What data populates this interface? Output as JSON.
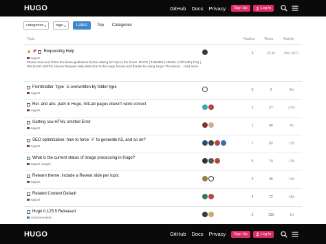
{
  "header": {
    "logo": "HUGO",
    "links": [
      "GitHub",
      "Docs",
      "Privacy"
    ],
    "signup": "Sign Up",
    "login": "Log In"
  },
  "filters": {
    "categories": "categories",
    "tags": "tags",
    "latest": "Latest",
    "top": "Top",
    "categories_tab": "Categories"
  },
  "table_headers": {
    "topic": "Topic",
    "replies": "Replies",
    "views": "Views",
    "activity": "Activity"
  },
  "topics": [
    {
      "title": "Requesting Help",
      "tag": "support",
      "tag_color": "#8b2f8b",
      "excerpt": "Please read and follow the below guidelines before asking for help in the forum. DOCS | THEMES | NEWS | GITHUB | FAQ | RELEASE NOTES How to Request Help Welcome to the Hugo forums and thanks for using Hugo! The below… read more",
      "replies": "9",
      "views": "25.4k",
      "activity": "Nov 2017",
      "pinned": true
    },
    {
      "title": "Frontmatter `type` is overwritten by folder type",
      "tag": "support",
      "tag_color": "#8b2f8b",
      "replies": "0",
      "views": "2",
      "activity": "4m"
    },
    {
      "title": "Rel. and abs. path in Hugo, GitLab pages doesn't work correct",
      "tag": "support",
      "tag_color": "#8b2f8b",
      "replies": "1",
      "views": "27",
      "activity": "37m"
    },
    {
      "title": "Getting raw HTML omitted Error",
      "tag": "support",
      "tag_color": "#8b2f8b",
      "replies": "1",
      "views": "40",
      "activity": "4h"
    },
    {
      "title": "SEO optimization: how to force `#` to generate h2, and so on?",
      "tag": "support",
      "tag_color": "#8b2f8b",
      "replies": "7",
      "views": "92",
      "activity": "12h"
    },
    {
      "title": "What is the current status of image processing in Hugo?",
      "tag": "support",
      "tag_color": "#8b2f8b",
      "tag2": "images",
      "replies": "5",
      "views": "74",
      "activity": "13h"
    },
    {
      "title": "Relearn theme: include a Reveal slide per topic",
      "tag": "support",
      "tag_color": "#8b2f8b",
      "replies": "0",
      "views": "46",
      "activity": "14h"
    },
    {
      "title": "Related Content Default",
      "tag": "support",
      "tag_color": "#8b2f8b",
      "replies": "4",
      "views": "72",
      "activity": "16h"
    },
    {
      "title": "Hugo 0.125.5 Released",
      "tag": "Announcements",
      "tag_color": "#2e7db8",
      "replies": "2",
      "views": "135",
      "activity": "1d"
    }
  ],
  "colors": {
    "accent": "#e02c6d",
    "latest": "#3c86c9",
    "hot": "#e26a2c"
  }
}
